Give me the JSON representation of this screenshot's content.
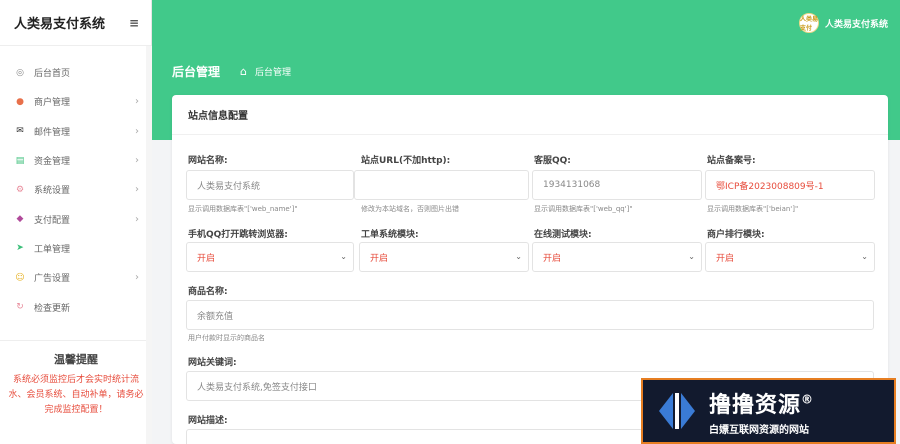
{
  "app": {
    "title": "人类易支付系统",
    "menu_toggle_icon": "menu-fold-icon"
  },
  "sidebar": {
    "items": [
      {
        "label": "后台首页",
        "icon": "dashboard-icon",
        "color": "#888888",
        "has_children": false
      },
      {
        "label": "商户管理",
        "icon": "user-icon",
        "color": "#e8704a",
        "has_children": true
      },
      {
        "label": "邮件管理",
        "icon": "mail-icon",
        "color": "#333333",
        "has_children": true
      },
      {
        "label": "资金管理",
        "icon": "wallet-icon",
        "color": "#3bbf7a",
        "has_children": true
      },
      {
        "label": "系统设置",
        "icon": "gear-icon",
        "color": "#e88a9a",
        "has_children": true
      },
      {
        "label": "支付配置",
        "icon": "payment-icon",
        "color": "#b04a9a",
        "has_children": true
      },
      {
        "label": "工单管理",
        "icon": "send-icon",
        "color": "#3bbf7a",
        "has_children": false
      },
      {
        "label": "广告设置",
        "icon": "ad-icon",
        "color": "#e6b020",
        "has_children": true
      },
      {
        "label": "检查更新",
        "icon": "update-icon",
        "color": "#e88a9a",
        "has_children": false
      }
    ],
    "tips_title": "温馨提醒",
    "tips_text": "系统必须监控后才会实时统计流水、会员系统、自动补单，请务必完成监控配置！"
  },
  "header": {
    "user_name": "人类易支付系统",
    "avatar_text": "人类易支付",
    "page_title": "后台管理",
    "breadcrumb": "后台管理"
  },
  "card": {
    "title": "站点信息配置",
    "row1": [
      {
        "label": "网站名称:",
        "value": "人类易支付系统",
        "help": "显示调用数据库表\"['web_name']\"",
        "red": false
      },
      {
        "label": "站点URL(不加http):",
        "value": "",
        "help": "修改为本站域名，否则图片出错",
        "red": false
      },
      {
        "label": "客服QQ:",
        "value": "1934131068",
        "help": "显示调用数据库表\"['web_qq']\"",
        "red": false
      },
      {
        "label": "站点备案号:",
        "value": "鄂ICP备2023008809号-1",
        "help": "显示调用数据库表\"['beian']\"",
        "red": true
      }
    ],
    "row2": [
      {
        "label": "手机QQ打开跳转浏览器:",
        "value": "开启"
      },
      {
        "label": "工单系统模块:",
        "value": "开启"
      },
      {
        "label": "在线测试模块:",
        "value": "开启"
      },
      {
        "label": "商户排行模块:",
        "value": "开启"
      }
    ],
    "product": {
      "label": "商品名称:",
      "value": "余额充值",
      "help": "用户付款时显示的商品名"
    },
    "keywords": {
      "label": "网站关键词:",
      "value": "人类易支付系统,免签支付接口"
    },
    "description": {
      "label": "网站描述:"
    }
  },
  "watermark": {
    "main": "撸撸资源",
    "reg": "®",
    "sub": "白嫖互联网资源的网站"
  },
  "colors": {
    "accent": "#41c98a",
    "danger": "#e74c3c",
    "watermark_bg": "#121a2e",
    "watermark_border": "#e67e22"
  }
}
